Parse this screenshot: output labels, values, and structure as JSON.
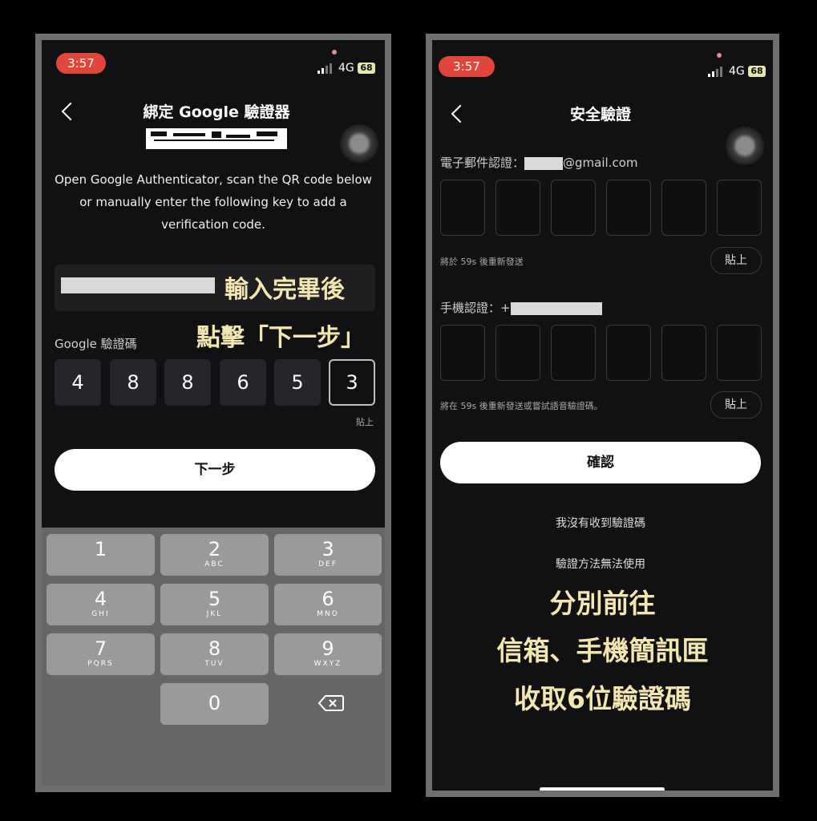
{
  "status_bar": {
    "time": "3:57",
    "network": "4G",
    "battery": "68"
  },
  "left": {
    "title": "綁定 Google 驗證器",
    "description": "Open Google Authenticator, scan the QR code below or manually enter the following key to add a verification code.",
    "overlay_line1": "輸入完畢後",
    "overlay_line2": "點擊「下一步」",
    "code_label": "Google 驗證碼",
    "code_digits": [
      "4",
      "8",
      "8",
      "6",
      "5",
      "3"
    ],
    "paste_label": "貼上",
    "next_button": "下一步",
    "keypad": [
      {
        "num": "1",
        "letters": ""
      },
      {
        "num": "2",
        "letters": "ABC"
      },
      {
        "num": "3",
        "letters": "DEF"
      },
      {
        "num": "4",
        "letters": "GHI"
      },
      {
        "num": "5",
        "letters": "JKL"
      },
      {
        "num": "6",
        "letters": "MNO"
      },
      {
        "num": "7",
        "letters": "PQRS"
      },
      {
        "num": "8",
        "letters": "TUV"
      },
      {
        "num": "9",
        "letters": "WXYZ"
      },
      {
        "num": "0",
        "letters": ""
      }
    ]
  },
  "right": {
    "title": "安全驗證",
    "email_label": "電子郵件認證：",
    "email_suffix": "@gmail.com",
    "email_resend": "將於 59s 後重新發送",
    "paste_label": "貼上",
    "phone_label": "手機認證：+",
    "phone_resend": "將在 59s 後重新發送或嘗試語音驗證碼。",
    "confirm_button": "確認",
    "no_code_link": "我沒有收到驗證碼",
    "method_unavailable": "驗證方法無法使用",
    "overlay_lines": [
      "分別前往",
      "信箱、手機簡訊匣",
      "收取6位驗證碼"
    ]
  }
}
